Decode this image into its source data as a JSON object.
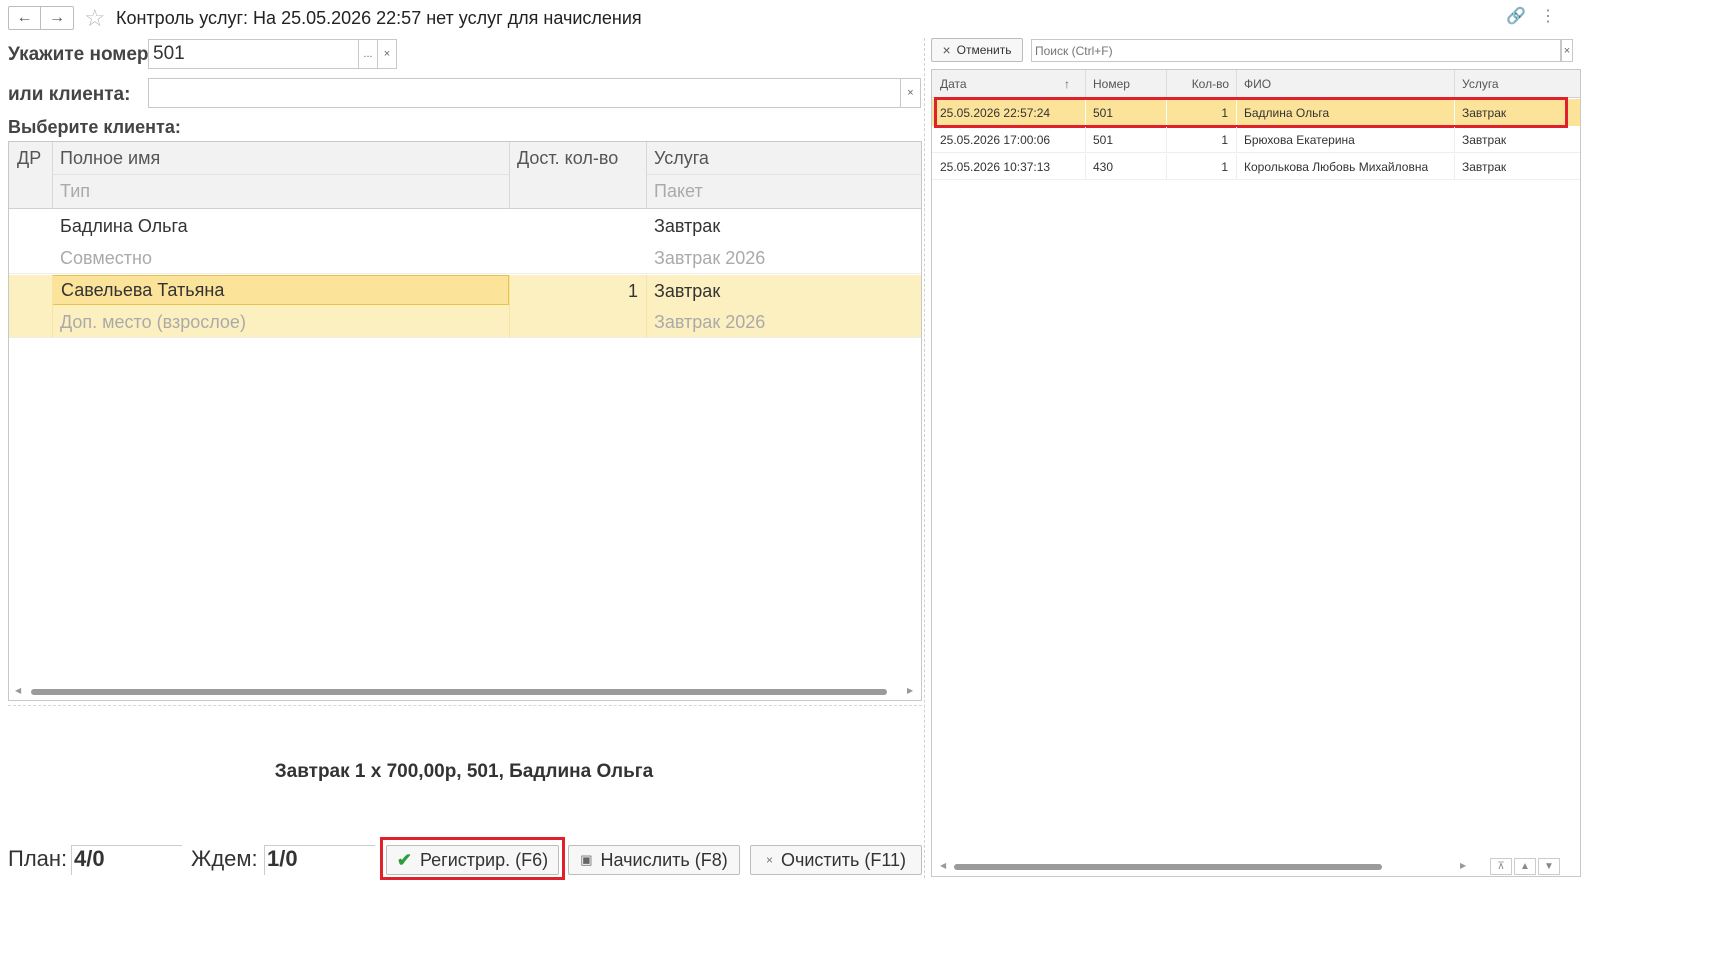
{
  "window": {
    "title": "Контроль услуг: На 25.05.2026 22:57 нет услуг для начисления",
    "back_icon": "arrow-left-icon",
    "forward_icon": "arrow-right-icon",
    "star_icon": "star-icon",
    "link_icon": "link-icon",
    "more_icon": "more-vertical-icon"
  },
  "form": {
    "number_label": "Укажите номер:",
    "number_value": "501",
    "select_btn": "...",
    "clear_btn": "×",
    "client_label": "или клиента:",
    "client_value": "",
    "client_clear_btn": "×",
    "choose_label": "Выберите клиента:"
  },
  "clients_table": {
    "headers": {
      "dr": "ДР",
      "full_name": "Полное имя",
      "type": "Тип",
      "qty": "Дост. кол-во",
      "service": "Услуга",
      "package": "Пакет"
    },
    "rows": [
      {
        "name": "Бадлина Ольга",
        "type": "Совместно",
        "qty": "",
        "service": "Завтрак",
        "package": "Завтрак 2026"
      },
      {
        "name": "Савельева Татьяна",
        "type": "Доп. место (взрослое)",
        "qty": "1",
        "service": "Завтрак",
        "package": "Завтрак 2026"
      }
    ]
  },
  "summary": "Завтрак 1 х 700,00р, 501, Бадлина Ольга",
  "footer": {
    "plan_label": "План:",
    "plan_value": "4/0",
    "wait_label": "Ждем:",
    "wait_value": "1/0",
    "register_btn": "Регистрир. (F6)",
    "charge_btn": "Начислить (F8)",
    "clear_btn": "Очистить (F11)"
  },
  "right_panel": {
    "cancel_btn": "Отменить",
    "search_placeholder": "Поиск (Ctrl+F)",
    "headers": {
      "date": "Дата",
      "number": "Номер",
      "qty": "Кол-во",
      "fio": "ФИО",
      "service": "Услуга"
    },
    "rows": [
      {
        "date": "25.05.2026 22:57:24",
        "number": "501",
        "qty": "1",
        "fio": "Бадлина Ольга",
        "service": "Завтрак"
      },
      {
        "date": "25.05.2026 17:00:06",
        "number": "501",
        "qty": "1",
        "fio": "Брюхова Екатерина",
        "service": "Завтрак"
      },
      {
        "date": "25.05.2026 10:37:13",
        "number": "430",
        "qty": "1",
        "fio": "Королькова Любовь Михайловна",
        "service": "Завтрак"
      }
    ]
  },
  "colors": {
    "selected_row": "#fdf0c0",
    "selected_cell": "#fbe39a",
    "highlight_border": "#e0202a",
    "check_green": "#2aa13a"
  }
}
